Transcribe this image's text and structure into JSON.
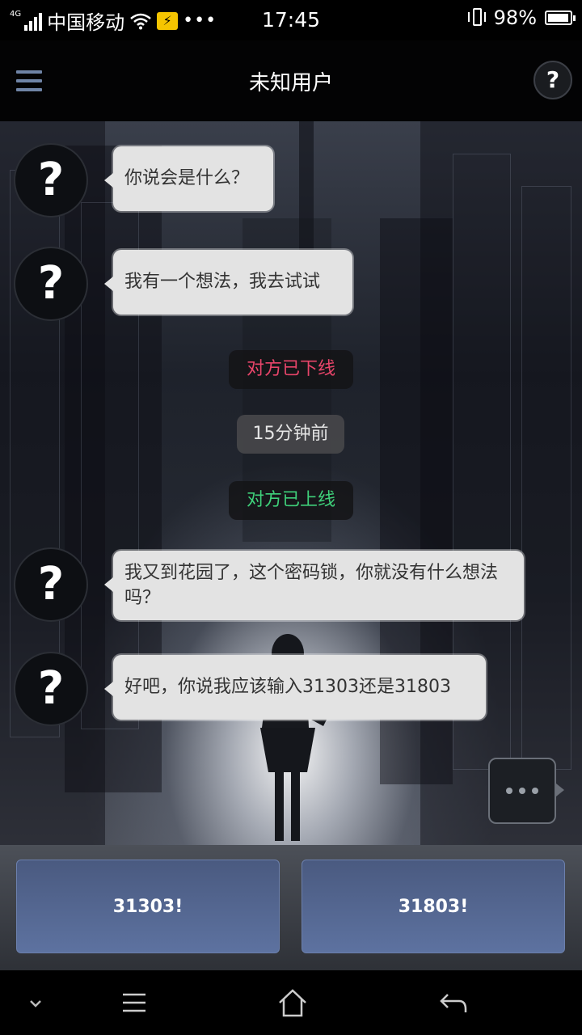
{
  "status_bar": {
    "network": "4G",
    "carrier": "中国移动",
    "more": "•••",
    "time": "17:45",
    "battery_percent": "98%",
    "battery_level": 0.98
  },
  "header": {
    "title": "未知用户",
    "help_icon": "?"
  },
  "chat": {
    "avatar_glyph": "?",
    "messages": [
      {
        "text": "你说会是什么？"
      },
      {
        "text": "我有一个想法，我去试试"
      },
      {
        "text": "我又到花园了，这个密码锁，你就没有什么想法吗？"
      },
      {
        "text": "好吧，你说我应该输入31303还是31803"
      }
    ],
    "system": [
      {
        "text": "对方已下线",
        "color": "#e8456a"
      },
      {
        "text": "15分钟前",
        "color": "#e6e6e6"
      },
      {
        "text": "对方已上线",
        "color": "#3fd07a"
      }
    ]
  },
  "choices": [
    {
      "label": "31303!"
    },
    {
      "label": "31803!"
    }
  ],
  "nav": {
    "icons": [
      "chevron-down-icon",
      "menu-icon",
      "home-icon",
      "back-icon"
    ]
  }
}
